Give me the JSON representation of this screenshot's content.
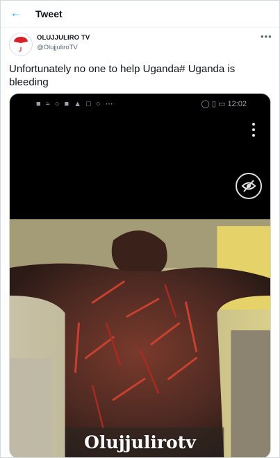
{
  "header": {
    "back_icon": "arrow-left-icon",
    "title": "Tweet"
  },
  "tweet": {
    "author_name": "OLUJJULIRO TV",
    "author_handle": "@OlujjuliroTV",
    "avatar_text": "Olujjuliro",
    "more_icon": "more-horizontal-icon",
    "text": "Unfortunately no one to help Uganda# Uganda is bleeding"
  },
  "media": {
    "status_bar_time": "12:02",
    "watermark": "Olujjulirotv",
    "hide_icon": "eye-slash-icon",
    "menu_icon": "kebab-menu-icon"
  },
  "colors": {
    "accent": "#1d9bf0",
    "text": "#0f1419",
    "muted": "#536471",
    "border": "#cfd9de"
  }
}
